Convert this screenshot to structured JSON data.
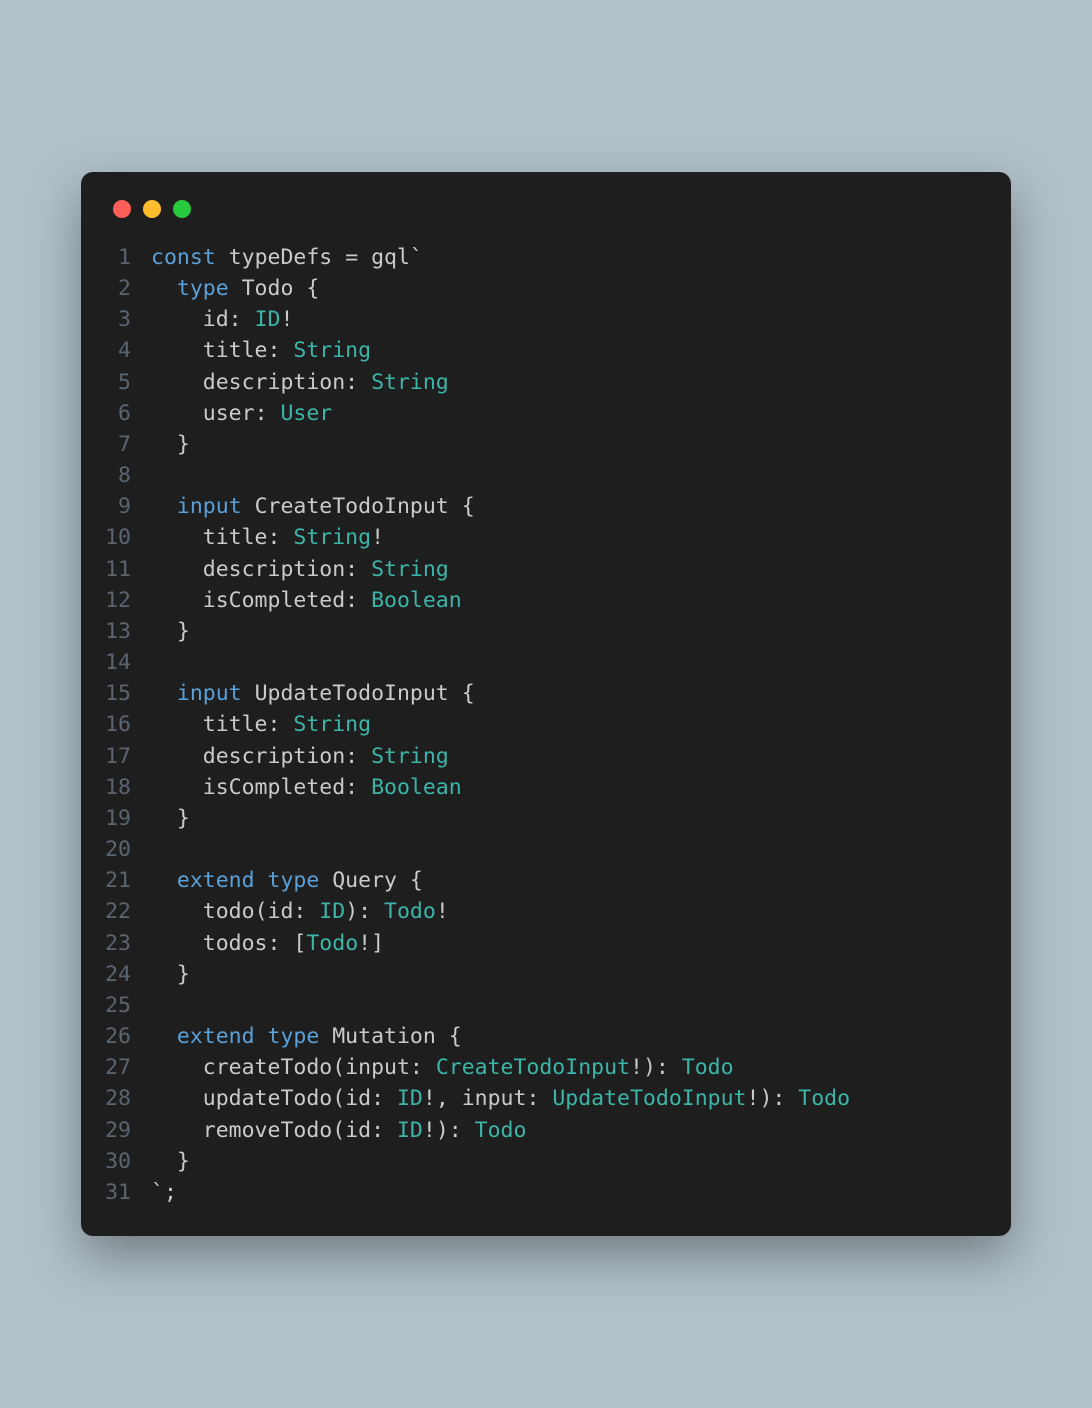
{
  "code": {
    "lines": [
      {
        "n": "1",
        "tokens": [
          {
            "c": "kw",
            "t": "const"
          },
          {
            "c": "fn",
            "t": " typeDefs "
          },
          {
            "c": "op",
            "t": "= "
          },
          {
            "c": "fn",
            "t": "gql"
          },
          {
            "c": "op",
            "t": "`"
          }
        ]
      },
      {
        "n": "2",
        "tokens": [
          {
            "c": "punct",
            "t": "  "
          },
          {
            "c": "kw",
            "t": "type"
          },
          {
            "c": "typename",
            "t": " Todo "
          },
          {
            "c": "brace",
            "t": "{"
          }
        ]
      },
      {
        "n": "3",
        "tokens": [
          {
            "c": "punct",
            "t": "    "
          },
          {
            "c": "field",
            "t": "id"
          },
          {
            "c": "punct",
            "t": ": "
          },
          {
            "c": "ftype",
            "t": "ID"
          },
          {
            "c": "bang",
            "t": "!"
          }
        ]
      },
      {
        "n": "4",
        "tokens": [
          {
            "c": "punct",
            "t": "    "
          },
          {
            "c": "field",
            "t": "title"
          },
          {
            "c": "punct",
            "t": ": "
          },
          {
            "c": "ftype",
            "t": "String"
          }
        ]
      },
      {
        "n": "5",
        "tokens": [
          {
            "c": "punct",
            "t": "    "
          },
          {
            "c": "field",
            "t": "description"
          },
          {
            "c": "punct",
            "t": ": "
          },
          {
            "c": "ftype",
            "t": "String"
          }
        ]
      },
      {
        "n": "6",
        "tokens": [
          {
            "c": "punct",
            "t": "    "
          },
          {
            "c": "field",
            "t": "user"
          },
          {
            "c": "punct",
            "t": ": "
          },
          {
            "c": "ftype",
            "t": "User"
          }
        ]
      },
      {
        "n": "7",
        "tokens": [
          {
            "c": "punct",
            "t": "  "
          },
          {
            "c": "brace",
            "t": "}"
          }
        ]
      },
      {
        "n": "8",
        "tokens": []
      },
      {
        "n": "9",
        "tokens": [
          {
            "c": "punct",
            "t": "  "
          },
          {
            "c": "kw",
            "t": "input"
          },
          {
            "c": "typename",
            "t": " CreateTodoInput "
          },
          {
            "c": "brace",
            "t": "{"
          }
        ]
      },
      {
        "n": "10",
        "tokens": [
          {
            "c": "punct",
            "t": "    "
          },
          {
            "c": "field",
            "t": "title"
          },
          {
            "c": "punct",
            "t": ": "
          },
          {
            "c": "ftype",
            "t": "String"
          },
          {
            "c": "bang",
            "t": "!"
          }
        ]
      },
      {
        "n": "11",
        "tokens": [
          {
            "c": "punct",
            "t": "    "
          },
          {
            "c": "field",
            "t": "description"
          },
          {
            "c": "punct",
            "t": ": "
          },
          {
            "c": "ftype",
            "t": "String"
          }
        ]
      },
      {
        "n": "12",
        "tokens": [
          {
            "c": "punct",
            "t": "    "
          },
          {
            "c": "field",
            "t": "isCompleted"
          },
          {
            "c": "punct",
            "t": ": "
          },
          {
            "c": "ftype",
            "t": "Boolean"
          }
        ]
      },
      {
        "n": "13",
        "tokens": [
          {
            "c": "punct",
            "t": "  "
          },
          {
            "c": "brace",
            "t": "}"
          }
        ]
      },
      {
        "n": "14",
        "tokens": []
      },
      {
        "n": "15",
        "tokens": [
          {
            "c": "punct",
            "t": "  "
          },
          {
            "c": "kw",
            "t": "input"
          },
          {
            "c": "typename",
            "t": " UpdateTodoInput "
          },
          {
            "c": "brace",
            "t": "{"
          }
        ]
      },
      {
        "n": "16",
        "tokens": [
          {
            "c": "punct",
            "t": "    "
          },
          {
            "c": "field",
            "t": "title"
          },
          {
            "c": "punct",
            "t": ": "
          },
          {
            "c": "ftype",
            "t": "String"
          }
        ]
      },
      {
        "n": "17",
        "tokens": [
          {
            "c": "punct",
            "t": "    "
          },
          {
            "c": "field",
            "t": "description"
          },
          {
            "c": "punct",
            "t": ": "
          },
          {
            "c": "ftype",
            "t": "String"
          }
        ]
      },
      {
        "n": "18",
        "tokens": [
          {
            "c": "punct",
            "t": "    "
          },
          {
            "c": "field",
            "t": "isCompleted"
          },
          {
            "c": "punct",
            "t": ": "
          },
          {
            "c": "ftype",
            "t": "Boolean"
          }
        ]
      },
      {
        "n": "19",
        "tokens": [
          {
            "c": "punct",
            "t": "  "
          },
          {
            "c": "brace",
            "t": "}"
          }
        ]
      },
      {
        "n": "20",
        "tokens": []
      },
      {
        "n": "21",
        "tokens": [
          {
            "c": "punct",
            "t": "  "
          },
          {
            "c": "kw",
            "t": "extend"
          },
          {
            "c": "punct",
            "t": " "
          },
          {
            "c": "kw",
            "t": "type"
          },
          {
            "c": "typename",
            "t": " Query "
          },
          {
            "c": "brace",
            "t": "{"
          }
        ]
      },
      {
        "n": "22",
        "tokens": [
          {
            "c": "punct",
            "t": "    "
          },
          {
            "c": "field",
            "t": "todo"
          },
          {
            "c": "punct",
            "t": "("
          },
          {
            "c": "field",
            "t": "id"
          },
          {
            "c": "punct",
            "t": ": "
          },
          {
            "c": "ftype",
            "t": "ID"
          },
          {
            "c": "punct",
            "t": "): "
          },
          {
            "c": "ftype",
            "t": "Todo"
          },
          {
            "c": "bang",
            "t": "!"
          }
        ]
      },
      {
        "n": "23",
        "tokens": [
          {
            "c": "punct",
            "t": "    "
          },
          {
            "c": "field",
            "t": "todos"
          },
          {
            "c": "punct",
            "t": ": ["
          },
          {
            "c": "ftype",
            "t": "Todo"
          },
          {
            "c": "bang",
            "t": "!"
          },
          {
            "c": "punct",
            "t": "]"
          }
        ]
      },
      {
        "n": "24",
        "tokens": [
          {
            "c": "punct",
            "t": "  "
          },
          {
            "c": "brace",
            "t": "}"
          }
        ]
      },
      {
        "n": "25",
        "tokens": []
      },
      {
        "n": "26",
        "tokens": [
          {
            "c": "punct",
            "t": "  "
          },
          {
            "c": "kw",
            "t": "extend"
          },
          {
            "c": "punct",
            "t": " "
          },
          {
            "c": "kw",
            "t": "type"
          },
          {
            "c": "typename",
            "t": " Mutation "
          },
          {
            "c": "brace",
            "t": "{"
          }
        ]
      },
      {
        "n": "27",
        "tokens": [
          {
            "c": "punct",
            "t": "    "
          },
          {
            "c": "field",
            "t": "createTodo"
          },
          {
            "c": "punct",
            "t": "("
          },
          {
            "c": "field",
            "t": "input"
          },
          {
            "c": "punct",
            "t": ": "
          },
          {
            "c": "ftype",
            "t": "CreateTodoInput"
          },
          {
            "c": "bang",
            "t": "!"
          },
          {
            "c": "punct",
            "t": "): "
          },
          {
            "c": "ftype",
            "t": "Todo"
          }
        ]
      },
      {
        "n": "28",
        "tokens": [
          {
            "c": "punct",
            "t": "    "
          },
          {
            "c": "field",
            "t": "updateTodo"
          },
          {
            "c": "punct",
            "t": "("
          },
          {
            "c": "field",
            "t": "id"
          },
          {
            "c": "punct",
            "t": ": "
          },
          {
            "c": "ftype",
            "t": "ID"
          },
          {
            "c": "bang",
            "t": "!"
          },
          {
            "c": "punct",
            "t": ", "
          },
          {
            "c": "field",
            "t": "input"
          },
          {
            "c": "punct",
            "t": ": "
          },
          {
            "c": "ftype",
            "t": "UpdateTodoInput"
          },
          {
            "c": "bang",
            "t": "!"
          },
          {
            "c": "punct",
            "t": "): "
          },
          {
            "c": "ftype",
            "t": "Todo"
          }
        ]
      },
      {
        "n": "29",
        "tokens": [
          {
            "c": "punct",
            "t": "    "
          },
          {
            "c": "field",
            "t": "removeTodo"
          },
          {
            "c": "punct",
            "t": "("
          },
          {
            "c": "field",
            "t": "id"
          },
          {
            "c": "punct",
            "t": ": "
          },
          {
            "c": "ftype",
            "t": "ID"
          },
          {
            "c": "bang",
            "t": "!"
          },
          {
            "c": "punct",
            "t": "): "
          },
          {
            "c": "ftype",
            "t": "Todo"
          }
        ]
      },
      {
        "n": "30",
        "tokens": [
          {
            "c": "punct",
            "t": "  "
          },
          {
            "c": "brace",
            "t": "}"
          }
        ]
      },
      {
        "n": "31",
        "tokens": [
          {
            "c": "op",
            "t": "`"
          },
          {
            "c": "punct",
            "t": ";"
          }
        ]
      }
    ]
  }
}
